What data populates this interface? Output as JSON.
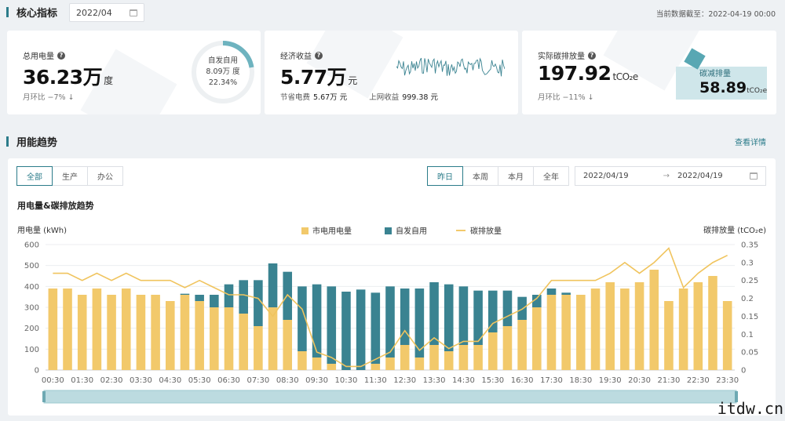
{
  "header": {
    "section_title": "核心指标",
    "month": "2022/04",
    "as_of": "当前数据截至：2022-04-19 00:00"
  },
  "cards": {
    "power": {
      "label": "总用电量",
      "value": "36.23万",
      "unit": "度",
      "mom": "月环比 −7% ↓",
      "donut_label": "自发自用",
      "donut_value": "8.09万 度",
      "donut_percent": "22.34%",
      "donut_fraction": 0.2234
    },
    "economy": {
      "label": "经济收益",
      "value": "5.77万",
      "unit": "元",
      "save_label": "节省电费",
      "save_value": "5.67万 元",
      "grid_label": "上网收益",
      "grid_value": "999.38 元"
    },
    "carbon": {
      "label": "实际碳排放量",
      "value": "197.92",
      "unit": "tCO₂e",
      "mom": "月环比 −11% ↓",
      "reduce_label": "碳减排量",
      "reduce_value": "58.89",
      "reduce_unit": "tCO₂e"
    }
  },
  "trend": {
    "section_title": "用能趋势",
    "detail_link": "查看详情",
    "filters": [
      "全部",
      "生产",
      "办公"
    ],
    "active_filter": 0,
    "periods": [
      "昨日",
      "本周",
      "本月",
      "全年"
    ],
    "active_period": 0,
    "date_start": "2022/04/19",
    "date_end": "2022/04/19",
    "arrow": "→",
    "chart_title": "用电量&碳排放趋势"
  },
  "colors": {
    "grid": "#f2c96b",
    "self": "#3a8391",
    "carbon": "#f2c96b",
    "accent": "#2b7c8a"
  },
  "chart_data": {
    "type": "bar",
    "ylabel": "用电量 (kWh)",
    "y2label": "碳排放量 (tCO₂e)",
    "ylim": [
      0,
      600
    ],
    "y2lim": [
      0,
      0.35
    ],
    "yticks": [
      0,
      100,
      200,
      300,
      400,
      500,
      600
    ],
    "y2ticks": [
      0,
      0.05,
      0.1,
      0.15,
      0.2,
      0.25,
      0.3,
      0.35
    ],
    "x_tick_labels": [
      "00:30",
      "01:30",
      "02:30",
      "03:30",
      "04:30",
      "05:30",
      "06:30",
      "07:30",
      "08:30",
      "09:30",
      "10:30",
      "11:30",
      "12:30",
      "13:30",
      "14:30",
      "15:30",
      "16:30",
      "17:30",
      "18:30",
      "19:30",
      "20:30",
      "21:30",
      "22:30",
      "23:30"
    ],
    "legend": [
      "市电用电量",
      "自发自用",
      "碳排放量"
    ],
    "grid": false,
    "series": [
      {
        "name": "市电用电量",
        "values": [
          390,
          390,
          360,
          390,
          360,
          390,
          360,
          360,
          330,
          360,
          330,
          300,
          300,
          270,
          210,
          300,
          240,
          90,
          60,
          30,
          0,
          0,
          30,
          60,
          120,
          60,
          120,
          90,
          120,
          120,
          180,
          210,
          240,
          300,
          360,
          360,
          360,
          390,
          420,
          390,
          420,
          480,
          330,
          390,
          420,
          450,
          330
        ]
      },
      {
        "name": "自发自用",
        "values": [
          0,
          0,
          0,
          0,
          0,
          0,
          0,
          0,
          0,
          5,
          30,
          60,
          110,
          160,
          220,
          210,
          230,
          310,
          350,
          370,
          375,
          385,
          340,
          340,
          270,
          330,
          300,
          320,
          280,
          260,
          200,
          170,
          110,
          60,
          30,
          10,
          0,
          0,
          0,
          0,
          0,
          0,
          0,
          0,
          0,
          0,
          0
        ]
      },
      {
        "name": "碳排放量",
        "values": [
          0.27,
          0.27,
          0.25,
          0.27,
          0.25,
          0.27,
          0.25,
          0.25,
          0.25,
          0.23,
          0.25,
          0.23,
          0.21,
          0.21,
          0.2,
          0.15,
          0.21,
          0.17,
          0.05,
          0.035,
          0.01,
          0.01,
          0.03,
          0.05,
          0.11,
          0.055,
          0.09,
          0.06,
          0.08,
          0.08,
          0.13,
          0.15,
          0.17,
          0.2,
          0.25,
          0.25,
          0.25,
          0.25,
          0.27,
          0.3,
          0.27,
          0.3,
          0.34,
          0.23,
          0.27,
          0.3,
          0.32
        ]
      }
    ]
  }
}
